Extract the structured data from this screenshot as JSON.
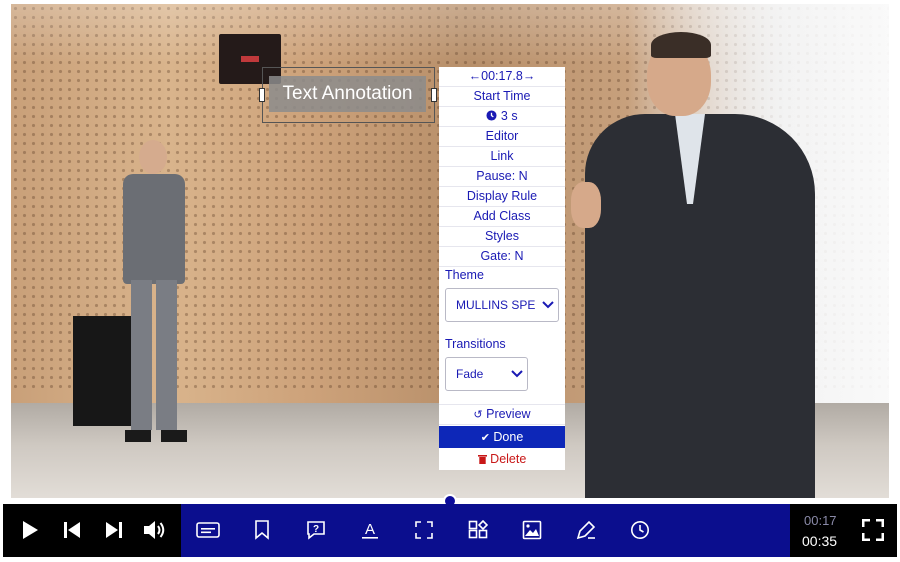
{
  "annotation": {
    "text": "Text Annotation"
  },
  "menu": {
    "time_nav": "←00:17.8→",
    "start_time": "Start Time",
    "duration": "3 s",
    "editor": "Editor",
    "link": "Link",
    "pause": "Pause: N",
    "display_rule": "Display Rule",
    "add_class": "Add Class",
    "styles": "Styles",
    "gate": "Gate: N",
    "theme_label": "Theme",
    "theme_value": "MULLINS SPEC",
    "transitions_label": "Transitions",
    "transitions_value": "Fade",
    "preview": "Preview",
    "done": "Done",
    "delete": "Delete"
  },
  "player": {
    "current_time": "00:17",
    "total_time": "00:35",
    "progress_fraction": 0.5
  },
  "colors": {
    "accent": "#0b0e8e",
    "link_text": "#1a1ab4",
    "done_bg": "#0d27b8",
    "delete_text": "#c81717"
  },
  "icons": [
    "play-icon",
    "skip-back-icon",
    "skip-forward-icon",
    "volume-icon",
    "captions-icon",
    "bookmark-icon",
    "question-icon",
    "text-icon",
    "crop-icon",
    "shapes-icon",
    "image-icon",
    "pen-icon",
    "clock-icon",
    "fullscreen-icon"
  ]
}
